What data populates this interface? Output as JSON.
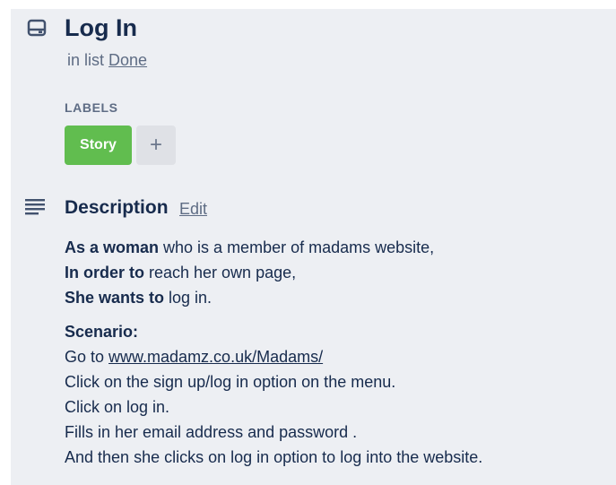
{
  "card": {
    "title": "Log In",
    "list_prefix": "in list",
    "list_name": "Done"
  },
  "labels": {
    "heading": "LABELS",
    "items": [
      {
        "text": "Story",
        "color": "#61bd4f"
      }
    ],
    "add_symbol": "+"
  },
  "description": {
    "heading": "Description",
    "edit_label": "Edit",
    "story": [
      {
        "bold": "As a woman",
        "rest": " who is a member of madams website,"
      },
      {
        "bold": "In order to",
        "rest": " reach her own page,"
      },
      {
        "bold": "She wants to",
        "rest": " log in."
      }
    ],
    "scenario_heading": "Scenario:",
    "go_to_prefix": "Go to ",
    "go_to_link": "www.madamz.co.uk/Madams/",
    "steps": [
      "Click on the sign up/log in option on the menu.",
      "Click on log in.",
      "Fills in her email address and password .",
      "And then she clicks on log in option to log into the website."
    ]
  },
  "icons": {
    "card": "card-icon",
    "description": "description-icon",
    "add": "plus-icon"
  },
  "colors": {
    "panel_bg": "#edeff3",
    "text_primary": "#172b4d",
    "text_muted": "#5e6c84",
    "label_green": "#61bd4f",
    "button_gray": "#dfe1e6"
  }
}
